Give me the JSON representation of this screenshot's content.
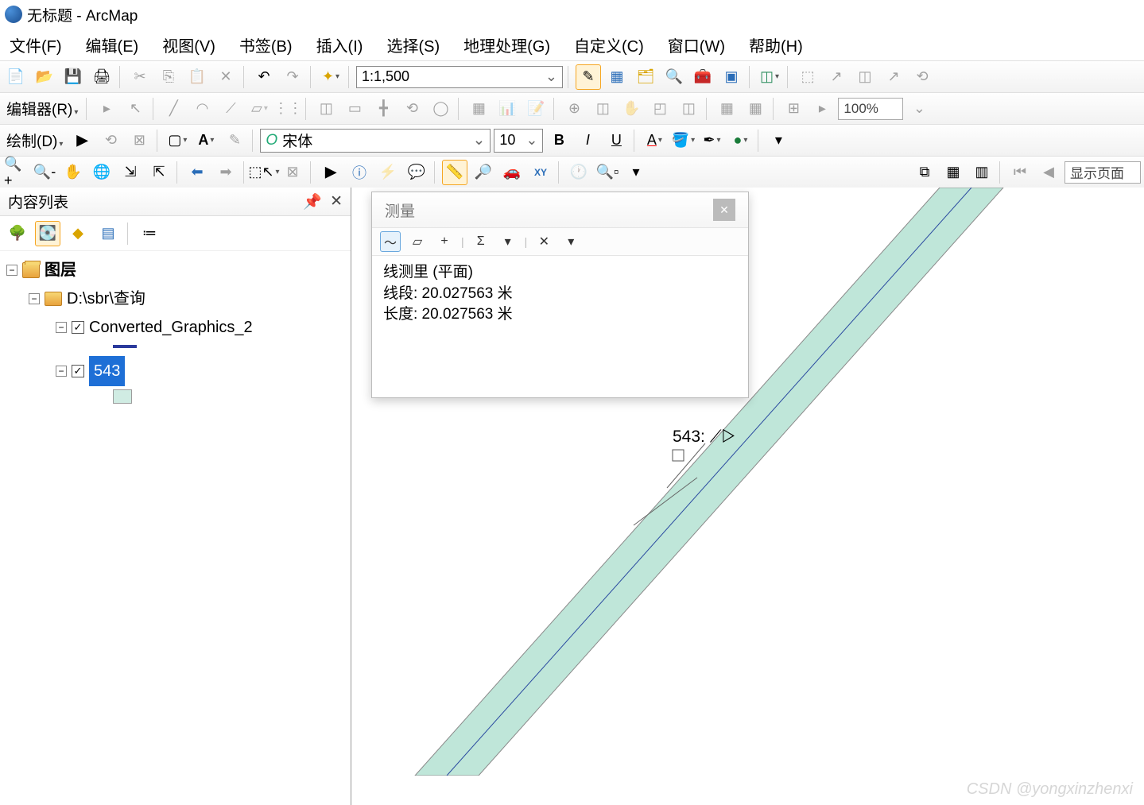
{
  "title": "无标题 - ArcMap",
  "menu": [
    "文件(F)",
    "编辑(E)",
    "视图(V)",
    "书签(B)",
    "插入(I)",
    "选择(S)",
    "地理处理(G)",
    "自定义(C)",
    "窗口(W)",
    "帮助(H)"
  ],
  "scale": "1:1,500",
  "editor_label": "编辑器(R)",
  "draw_label": "绘制(D)",
  "font_name": "宋体",
  "font_size": "10",
  "zoom": "100%",
  "show_page": "显示页面",
  "sidebar": {
    "title": "内容列表",
    "root": "图层",
    "folder_path": "D:\\sbr\\查询",
    "layers": [
      {
        "name": "Converted_Graphics_2",
        "checked": true,
        "selected": false
      },
      {
        "name": "543",
        "checked": true,
        "selected": true
      }
    ]
  },
  "measure": {
    "title": "测量",
    "line1": "线测里 (平面)",
    "line2": "线段: 20.027563 米",
    "line3": "长度: 20.027563 米"
  },
  "map_label": "543:",
  "watermark": "CSDN @yongxinzhenxi"
}
